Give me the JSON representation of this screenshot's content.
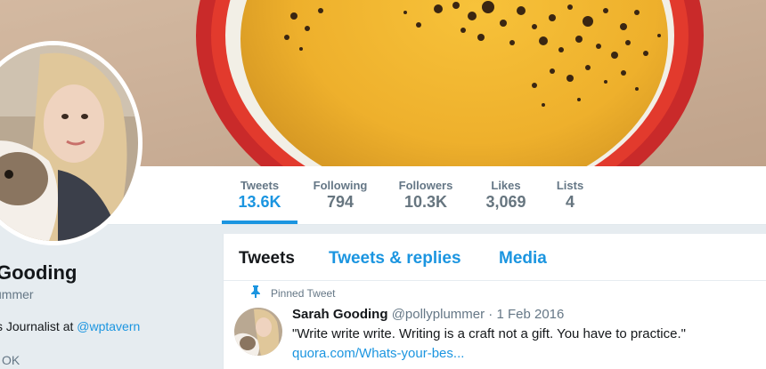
{
  "header": {
    "banner_image": "coffee-cup-photo"
  },
  "stats": [
    {
      "label": "Tweets",
      "value": "13.6K",
      "active": true
    },
    {
      "label": "Following",
      "value": "794",
      "active": false
    },
    {
      "label": "Followers",
      "value": "10.3K",
      "active": false
    },
    {
      "label": "Likes",
      "value": "3,069",
      "active": false
    },
    {
      "label": "Lists",
      "value": "4",
      "active": false
    }
  ],
  "profile": {
    "name": "Gooding",
    "handle": "ummer",
    "bio_prefix": "s Journalist at ",
    "bio_link": "@wptavern",
    "location": "OK"
  },
  "tabs": [
    {
      "label": "Tweets",
      "active": true
    },
    {
      "label": "Tweets & replies",
      "active": false
    },
    {
      "label": "Media",
      "active": false
    }
  ],
  "tweet": {
    "pinned_label": "Pinned Tweet",
    "name": "Sarah Gooding",
    "handle": "@pollyplummer",
    "dot": "·",
    "date": "1 Feb 2016",
    "text": "\"Write write write. Writing is a craft not a gift. You have to practice.\"",
    "link": "quora.com/Whats-your-bes..."
  },
  "colors": {
    "accent": "#1b95e0",
    "background": "#e6ecf0"
  }
}
